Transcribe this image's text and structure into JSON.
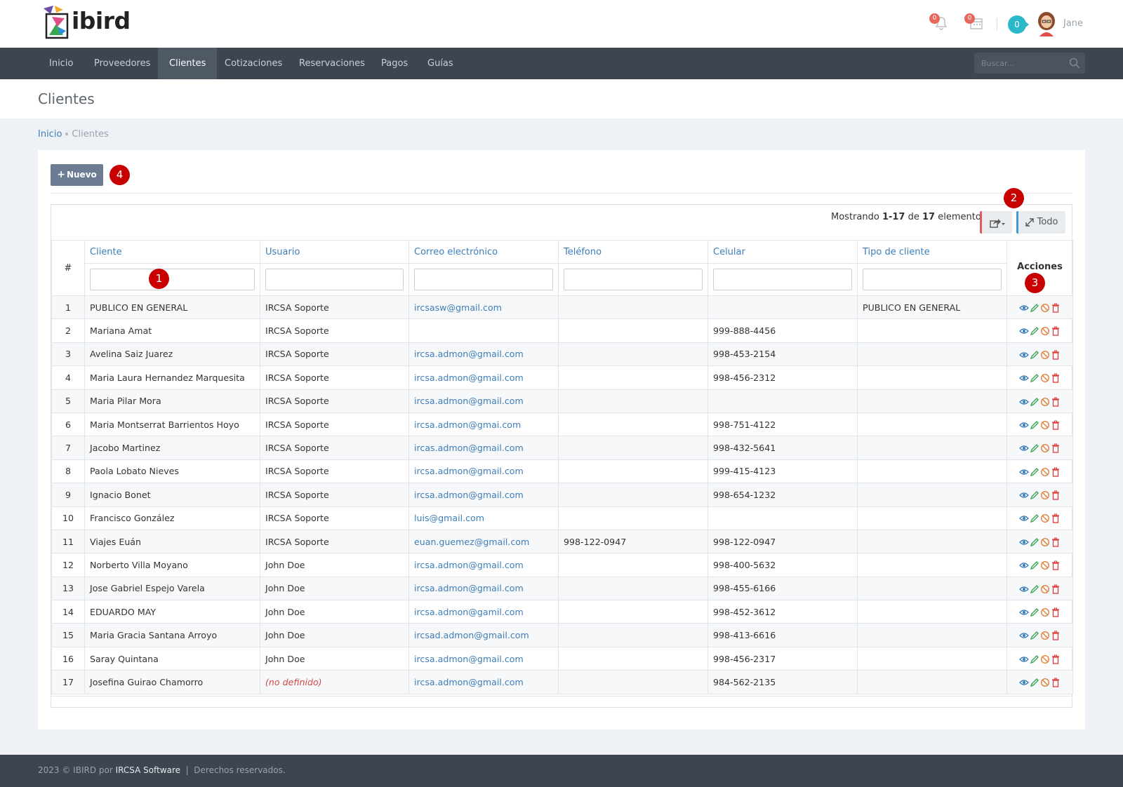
{
  "app": {
    "logo_text": "ibird"
  },
  "header": {
    "notifications_count": "0",
    "calendar_count": "0",
    "cart_count": "0",
    "username": "Jane"
  },
  "nav": {
    "items": [
      {
        "label": "Inicio"
      },
      {
        "label": "Proveedores"
      },
      {
        "label": "Clientes",
        "active": true
      },
      {
        "label": "Cotizaciones"
      },
      {
        "label": "Reservaciones"
      },
      {
        "label": "Pagos"
      },
      {
        "label": "Guías"
      }
    ],
    "search_placeholder": "Buscar..."
  },
  "page": {
    "title": "Clientes"
  },
  "breadcrumb": {
    "home": "Inicio",
    "current": "Clientes"
  },
  "toolbar": {
    "new_label": "Nuevo"
  },
  "markers": [
    "1",
    "2",
    "3",
    "4"
  ],
  "grid": {
    "summary_prefix": "Mostrando ",
    "summary_range": "1-17",
    "summary_mid": " de ",
    "summary_total": "17",
    "summary_suffix": " elementos.",
    "todo_label": "Todo",
    "columns": {
      "num": "#",
      "cliente": "Cliente",
      "usuario": "Usuario",
      "correo": "Correo electrónico",
      "telefono": "Teléfono",
      "celular": "Celular",
      "tipo": "Tipo de cliente",
      "acciones": "Acciones"
    },
    "rows": [
      {
        "n": "1",
        "cliente": "PUBLICO EN GENERAL",
        "usuario": "IRCSA Soporte",
        "correo": "ircsasw@gmail.com",
        "telefono": "",
        "celular": "",
        "tipo": "PUBLICO EN GENERAL"
      },
      {
        "n": "2",
        "cliente": "Mariana Amat",
        "usuario": "IRCSA Soporte",
        "correo": "",
        "telefono": "",
        "celular": "999-888-4456",
        "tipo": ""
      },
      {
        "n": "3",
        "cliente": "Avelina Saiz Juarez",
        "usuario": "IRCSA Soporte",
        "correo": "ircsa.admon@gmail.com",
        "telefono": "",
        "celular": "998-453-2154",
        "tipo": ""
      },
      {
        "n": "4",
        "cliente": "Maria Laura Hernandez Marquesita",
        "usuario": "IRCSA Soporte",
        "correo": "ircsa.admon@gmail.com",
        "telefono": "",
        "celular": "998-456-2312",
        "tipo": ""
      },
      {
        "n": "5",
        "cliente": "Maria Pilar Mora",
        "usuario": "IRCSA Soporte",
        "correo": "ircsa.admon@gmail.com",
        "telefono": "",
        "celular": "",
        "tipo": ""
      },
      {
        "n": "6",
        "cliente": "Maria Montserrat Barrientos Hoyo",
        "usuario": "IRCSA Soporte",
        "correo": "ircsa.admon@gmai.com",
        "telefono": "",
        "celular": "998-751-4122",
        "tipo": ""
      },
      {
        "n": "7",
        "cliente": "Jacobo Martinez",
        "usuario": "IRCSA Soporte",
        "correo": "ircas.admon@gmail.com",
        "telefono": "",
        "celular": "998-432-5641",
        "tipo": ""
      },
      {
        "n": "8",
        "cliente": "Paola Lobato Nieves",
        "usuario": "IRCSA Soporte",
        "correo": "ircsa.admon@gmail.com",
        "telefono": "",
        "celular": "999-415-4123",
        "tipo": ""
      },
      {
        "n": "9",
        "cliente": "Ignacio Bonet",
        "usuario": "IRCSA Soporte",
        "correo": "ircsa.admon@gmail.com",
        "telefono": "",
        "celular": "998-654-1232",
        "tipo": ""
      },
      {
        "n": "10",
        "cliente": "Francisco González",
        "usuario": "IRCSA Soporte",
        "correo": "luis@gmail.com",
        "telefono": "",
        "celular": "",
        "tipo": ""
      },
      {
        "n": "11",
        "cliente": "Viajes Euán",
        "usuario": "IRCSA Soporte",
        "correo": "euan.guemez@gmail.com",
        "telefono": "998-122-0947",
        "celular": "998-122-0947",
        "tipo": ""
      },
      {
        "n": "12",
        "cliente": "Norberto Villa Moyano",
        "usuario": "John Doe",
        "correo": "ircsa.admon@gmail.com",
        "telefono": "",
        "celular": "998-400-5632",
        "tipo": ""
      },
      {
        "n": "13",
        "cliente": "Jose Gabriel Espejo Varela",
        "usuario": "John Doe",
        "correo": "ircsa.admon@gmail.com",
        "telefono": "",
        "celular": "998-455-6166",
        "tipo": ""
      },
      {
        "n": "14",
        "cliente": "EDUARDO MAY",
        "usuario": "John Doe",
        "correo": "ircsa.admon@gamil.com",
        "telefono": "",
        "celular": "998-452-3612",
        "tipo": ""
      },
      {
        "n": "15",
        "cliente": "Maria Gracia Santana Arroyo",
        "usuario": "John Doe",
        "correo": "ircsad.admon@gmail.com",
        "telefono": "",
        "celular": "998-413-6616",
        "tipo": ""
      },
      {
        "n": "16",
        "cliente": "Saray Quintana",
        "usuario": "John Doe",
        "correo": "ircsa.admon@gmail.com",
        "telefono": "",
        "celular": "998-456-2317",
        "tipo": ""
      },
      {
        "n": "17",
        "cliente": "Josefina Guirao Chamorro",
        "usuario": "(no definido)",
        "usuario_undefined": true,
        "correo": "ircsa.admon@gmail.com",
        "telefono": "",
        "celular": "984-562-2135",
        "tipo": ""
      }
    ]
  },
  "footer": {
    "prefix": "2023 © IBIRD por ",
    "brand": "IRCSA Software",
    "suffix": "  |  Derechos reservados."
  },
  "colors": {
    "nav_bg": "#3c4550",
    "link": "#3d7eb8",
    "marker": "#c80000",
    "badge": "#e7675c",
    "cart": "#2bb8c9"
  },
  "icons": {
    "row_actions": [
      "eye-icon",
      "pencil-icon",
      "ban-icon",
      "trash-icon"
    ]
  }
}
